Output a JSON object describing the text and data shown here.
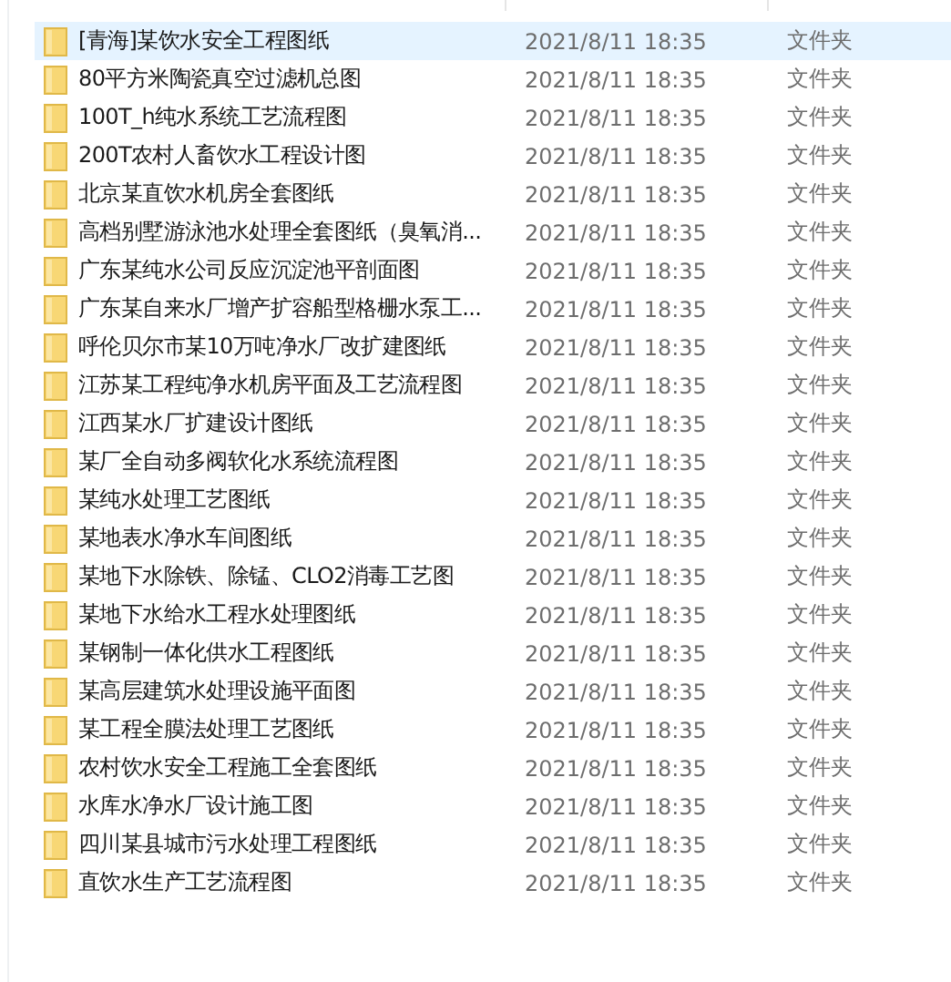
{
  "files": [
    {
      "name": "[青海]某饮水安全工程图纸",
      "modified": "2021/8/11 18:35",
      "type": "文件夹",
      "selected": true
    },
    {
      "name": "80平方米陶瓷真空过滤机总图",
      "modified": "2021/8/11 18:35",
      "type": "文件夹",
      "selected": false
    },
    {
      "name": "100T_h纯水系统工艺流程图",
      "modified": "2021/8/11 18:35",
      "type": "文件夹",
      "selected": false
    },
    {
      "name": "200T农村人畜饮水工程设计图",
      "modified": "2021/8/11 18:35",
      "type": "文件夹",
      "selected": false
    },
    {
      "name": "北京某直饮水机房全套图纸",
      "modified": "2021/8/11 18:35",
      "type": "文件夹",
      "selected": false
    },
    {
      "name": "高档别墅游泳池水处理全套图纸（臭氧消...",
      "modified": "2021/8/11 18:35",
      "type": "文件夹",
      "selected": false
    },
    {
      "name": "广东某纯水公司反应沉淀池平剖面图",
      "modified": "2021/8/11 18:35",
      "type": "文件夹",
      "selected": false
    },
    {
      "name": "广东某自来水厂增产扩容船型格栅水泵工...",
      "modified": "2021/8/11 18:35",
      "type": "文件夹",
      "selected": false
    },
    {
      "name": "呼伦贝尔市某10万吨净水厂改扩建图纸",
      "modified": "2021/8/11 18:35",
      "type": "文件夹",
      "selected": false
    },
    {
      "name": "江苏某工程纯净水机房平面及工艺流程图",
      "modified": "2021/8/11 18:35",
      "type": "文件夹",
      "selected": false
    },
    {
      "name": "江西某水厂扩建设计图纸",
      "modified": "2021/8/11 18:35",
      "type": "文件夹",
      "selected": false
    },
    {
      "name": "某厂全自动多阀软化水系统流程图",
      "modified": "2021/8/11 18:35",
      "type": "文件夹",
      "selected": false
    },
    {
      "name": "某纯水处理工艺图纸",
      "modified": "2021/8/11 18:35",
      "type": "文件夹",
      "selected": false
    },
    {
      "name": "某地表水净水车间图纸",
      "modified": "2021/8/11 18:35",
      "type": "文件夹",
      "selected": false
    },
    {
      "name": "某地下水除铁、除锰、CLO2消毒工艺图",
      "modified": "2021/8/11 18:35",
      "type": "文件夹",
      "selected": false
    },
    {
      "name": "某地下水给水工程水处理图纸",
      "modified": "2021/8/11 18:35",
      "type": "文件夹",
      "selected": false
    },
    {
      "name": "某钢制一体化供水工程图纸",
      "modified": "2021/8/11 18:35",
      "type": "文件夹",
      "selected": false
    },
    {
      "name": "某高层建筑水处理设施平面图",
      "modified": "2021/8/11 18:35",
      "type": "文件夹",
      "selected": false
    },
    {
      "name": "某工程全膜法处理工艺图纸",
      "modified": "2021/8/11 18:35",
      "type": "文件夹",
      "selected": false
    },
    {
      "name": "农村饮水安全工程施工全套图纸",
      "modified": "2021/8/11 18:35",
      "type": "文件夹",
      "selected": false
    },
    {
      "name": "水库水净水厂设计施工图",
      "modified": "2021/8/11 18:35",
      "type": "文件夹",
      "selected": false
    },
    {
      "name": "四川某县城市污水处理工程图纸",
      "modified": "2021/8/11 18:35",
      "type": "文件夹",
      "selected": false
    },
    {
      "name": "直饮水生产工艺流程图",
      "modified": "2021/8/11 18:35",
      "type": "文件夹",
      "selected": false
    }
  ]
}
